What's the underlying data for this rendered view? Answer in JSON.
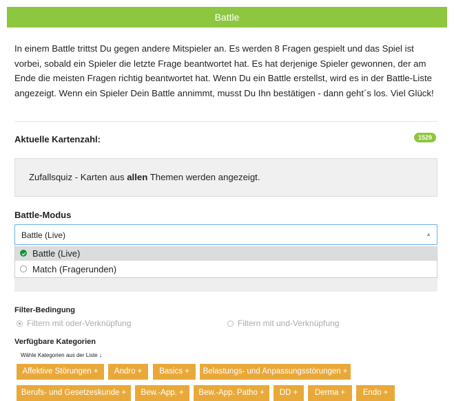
{
  "header": {
    "title": "Battle"
  },
  "intro": {
    "text": "In einem Battle trittst Du gegen andere Mitspieler an. Es werden 8 Fragen gespielt und das Spiel ist vorbei, sobald ein Spieler die letzte Frage beantwortet hat. Es hat derjenige Spieler gewonnen, der am Ende die meisten Fragen richtig beantwortet hat. Wenn Du ein Battle erstellst, wird es in der Battle-Liste angezeigt. Wenn ein Spieler Dein Battle annimmt, musst Du Ihn bestätigen - dann geht´s los. Viel Glück!"
  },
  "card_count": {
    "label": "Aktuelle Kartenzahl:",
    "value": "1529"
  },
  "info": {
    "prefix": "Zufallsquiz - Karten aus ",
    "bold": "allen",
    "suffix": " Themen werden angezeigt."
  },
  "mode": {
    "label": "Battle-Modus",
    "selected": "Battle (Live)",
    "options": [
      {
        "label": "Battle (Live)",
        "selected": true
      },
      {
        "label": "Match (Fragerunden)",
        "selected": false
      }
    ]
  },
  "filter": {
    "label": "Filter-Bedingung",
    "options": [
      {
        "label": "Filtern mit oder-Verknüpfung",
        "selected": true
      },
      {
        "label": "Filtern mit und-Verknüpfung",
        "selected": false
      }
    ]
  },
  "categories": {
    "label": "Verfügbare Kategorien",
    "hint": "Wähle Kategorien aus der Liste ↓",
    "plus": "+",
    "items": [
      "Affektive Störungen",
      "Andro",
      "Basics",
      "Belastungs- und Anpassungsstörungen",
      "Berufs- und Gesetzeskunde",
      "Bew.-App.",
      "Bew.-App. Patho",
      "DD",
      "Derma",
      "Endo"
    ]
  },
  "colors": {
    "header": "#8dc63f",
    "badge": "#8dc63f",
    "chip": "#e9a93a",
    "selected_radio": "#1c8f3a",
    "focus_border": "#66afe9"
  }
}
